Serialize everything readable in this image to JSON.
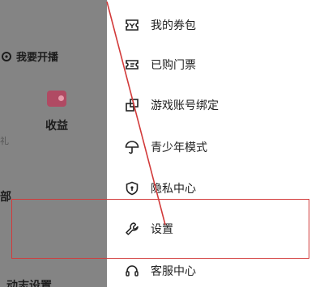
{
  "background_page": {
    "open_stream_label": "我要开播",
    "earnings_label": "收益",
    "partial_text_li": "礼",
    "partial_text_bu": "部",
    "partial_settings": "动志设置"
  },
  "drawer_menu": {
    "items": [
      {
        "label": "我的券包",
        "icon": "coupon-icon"
      },
      {
        "label": "已购门票",
        "icon": "ticket-icon"
      },
      {
        "label": "游戏账号绑定",
        "icon": "link-icon"
      },
      {
        "label": "青少年模式",
        "icon": "umbrella-icon"
      },
      {
        "label": "隐私中心",
        "icon": "shield-icon"
      },
      {
        "label": "设置",
        "icon": "wrench-icon"
      },
      {
        "label": "客服中心",
        "icon": "headset-icon"
      }
    ]
  },
  "colors": {
    "annotation": "#d23a3a",
    "overlay": "#848484"
  }
}
